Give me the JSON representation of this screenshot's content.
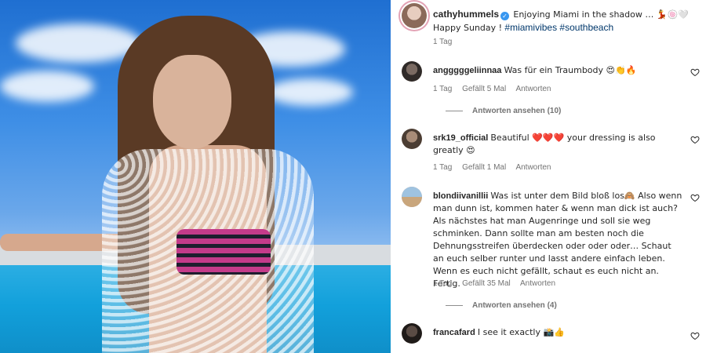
{
  "post": {
    "username": "cathyhummels",
    "verified_icon": "verified-badge-icon",
    "caption": "Enjoying Miami in the shadow … 💃🍥🤍 Happy Sunday !",
    "hashtags": "#miamivibes #southbeach",
    "time": "1 Tag"
  },
  "comments": [
    {
      "username": "angggggeliinnaa",
      "text": "Was für ein Traumbody 😍👏🔥",
      "time": "1 Tag",
      "likes": "Gefällt 5 Mal",
      "reply": "Antworten",
      "view_replies": "Antworten ansehen (10)"
    },
    {
      "username": "srk19_official",
      "text": "Beautiful ❤️❤️❤️ your dressing is also greatly 😍",
      "time": "1 Tag",
      "likes": "Gefällt 1 Mal",
      "reply": "Antworten"
    },
    {
      "username": "blondiivanillii",
      "text": "Was ist unter dem Bild bloß los🙈 Also wenn man dunn ist, kommen hater & wenn man dick ist auch? Als nächstes hat man Augenringe und soll sie weg schminken. Dann sollte man am besten noch die Dehnungsstreifen überdecken oder oder oder… Schaut an euch selber runter und lasst andere einfach leben. Wenn es euch nicht gefällt, schaut es euch nicht an. Fertig.",
      "time": "1 Tag",
      "likes": "Gefällt 35 Mal",
      "reply": "Antworten",
      "view_replies": "Antworten ansehen (4)"
    },
    {
      "username": "francafard",
      "text": "I see it exactly 📸👍"
    }
  ],
  "icons": {
    "like": "heart-outline-icon"
  },
  "colors": {
    "text": "#262626",
    "muted": "#737373",
    "hashtag": "#00376b",
    "verified": "#3897f0"
  }
}
